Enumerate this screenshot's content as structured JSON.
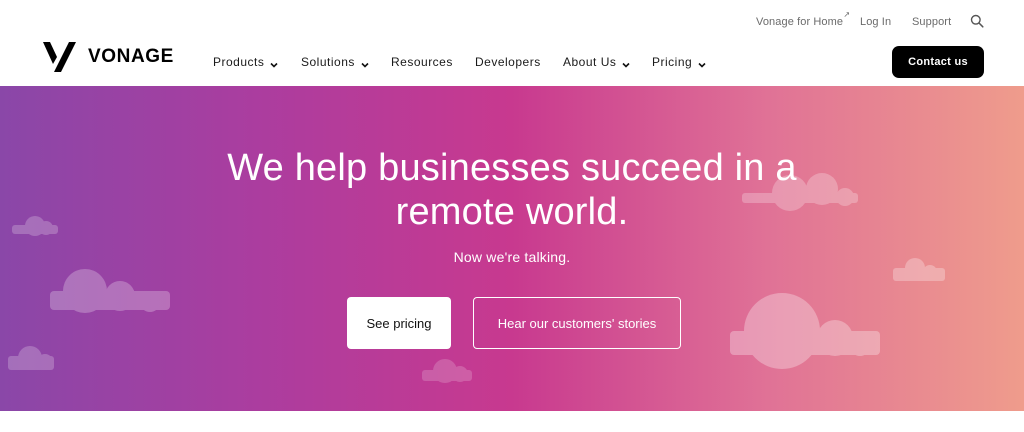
{
  "utility_nav": {
    "home_label": "Vonage for Home",
    "home_external_glyph": "↗",
    "login_label": "Log In",
    "support_label": "Support",
    "search_icon": "search-icon"
  },
  "brand": {
    "name": "VONAGE",
    "logo_icon": "vonage-v-logo"
  },
  "main_nav": {
    "items": [
      {
        "label": "Products",
        "has_dropdown": true
      },
      {
        "label": "Solutions",
        "has_dropdown": true
      },
      {
        "label": "Resources",
        "has_dropdown": false
      },
      {
        "label": "Developers",
        "has_dropdown": false
      },
      {
        "label": "About Us",
        "has_dropdown": true
      },
      {
        "label": "Pricing",
        "has_dropdown": true
      }
    ],
    "contact_label": "Contact us"
  },
  "hero": {
    "title_line1": "We help businesses succeed in a",
    "title_line2": "remote world.",
    "subtitle": "Now we're talking.",
    "primary_button": "See pricing",
    "secondary_button": "Hear our customers' stories"
  },
  "colors": {
    "hero_gradient_start": "#8a47a8",
    "hero_gradient_mid": "#c8398f",
    "hero_gradient_end": "#ef9c8c",
    "contact_button_bg": "#000000"
  }
}
